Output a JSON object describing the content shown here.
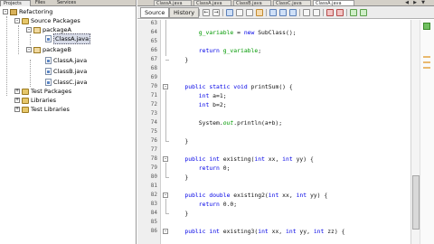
{
  "left_panel": {
    "tabs": [
      "Projects",
      "Files",
      "Services"
    ],
    "tree": {
      "project": "Refactoring",
      "source_packages": "Source Packages",
      "packageA": "packageA",
      "packageA_files": [
        "ClassA.java"
      ],
      "packageB": "packageB",
      "packageB_files": [
        "ClassA.java",
        "ClassB.java",
        "ClassC.java"
      ],
      "test_packages": "Test Packages",
      "libraries": "Libraries",
      "test_libraries": "Test Libraries"
    }
  },
  "editor_tabs": [
    "ClassA.java",
    "ClassA.java",
    "ClassB.java",
    "ClassC.java",
    "ClassA.java"
  ],
  "toolbar": {
    "source_label": "Source",
    "history_label": "History",
    "icons": [
      "back-icon",
      "forward-icon",
      "find-icon",
      "prev-occurrence-icon",
      "next-occurrence-icon",
      "toggle-highlight-icon",
      "toggle-bookmark-icon",
      "prev-bookmark-icon",
      "next-bookmark-icon",
      "shift-left-icon",
      "shift-right-icon",
      "run-macro-icon",
      "stop-macro-icon",
      "comment-icon",
      "uncomment-icon"
    ]
  },
  "editor": {
    "line_numbers": [
      63,
      64,
      65,
      66,
      67,
      68,
      69,
      70,
      71,
      72,
      73,
      74,
      75,
      76,
      77,
      78,
      79,
      80,
      81,
      82,
      83,
      84,
      85,
      86
    ],
    "lines": [
      "",
      "        g_variable = new SubClass();",
      "",
      "        return g_variable;",
      "    }",
      "",
      "",
      "    public static void printSum() {",
      "        int a=1;",
      "        int b=2;",
      "",
      "        System.out.println(a+b);",
      "",
      "    }",
      "",
      "    public int existing(int xx, int yy) {",
      "        return 0;",
      "    }",
      "",
      "    public double existing2(int xx, int yy) {",
      "        return 0.0;",
      "    }",
      "",
      "    public int existing3(int xx, int yy, int zz) {"
    ]
  },
  "colors": {
    "keyword": "#0000e6",
    "field": "#009900",
    "gutter": "#efefef",
    "chrome": "#d4d0c8"
  }
}
